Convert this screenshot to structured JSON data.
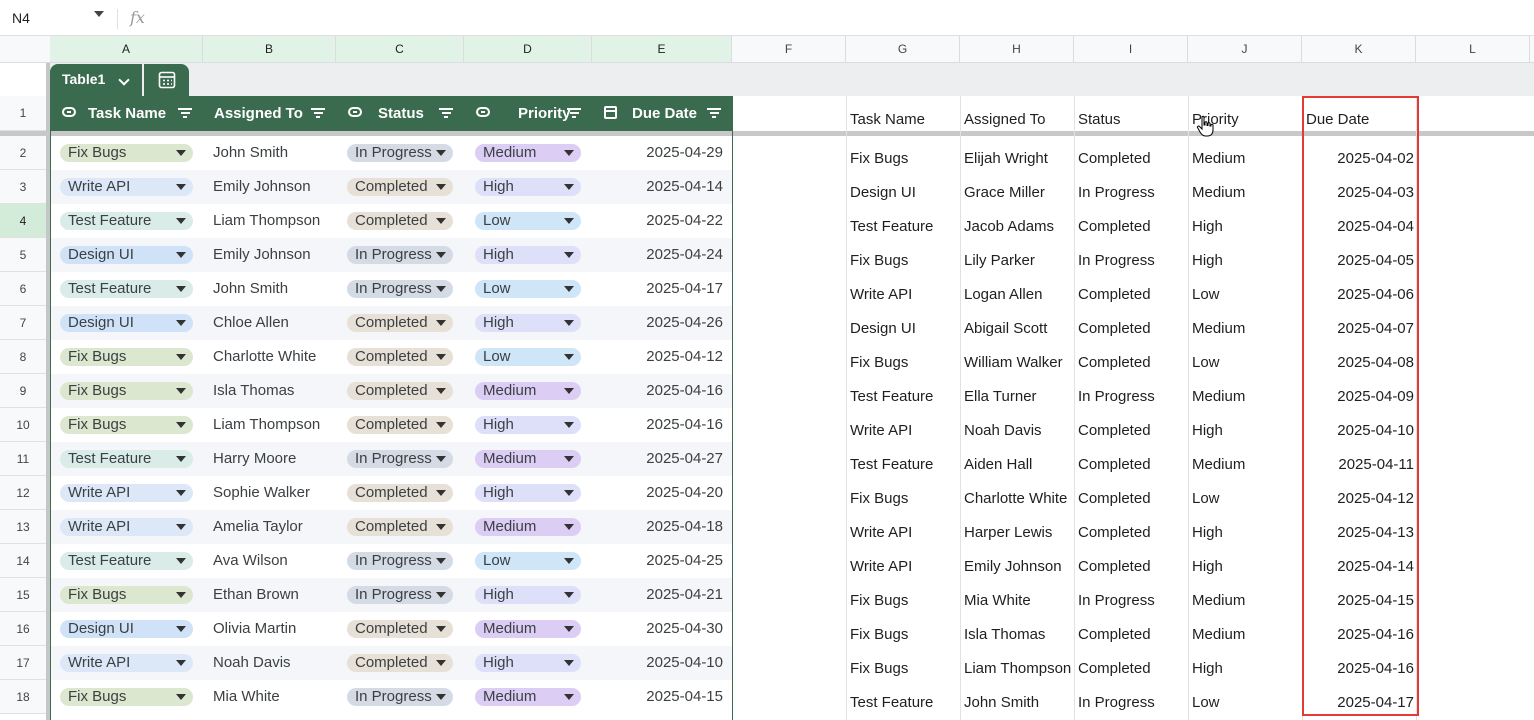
{
  "formula_bar": {
    "name_box": "N4",
    "fx": "fx",
    "formula": ""
  },
  "columns": [
    "A",
    "B",
    "C",
    "D",
    "E",
    "F",
    "G",
    "H",
    "I",
    "J",
    "K",
    "L"
  ],
  "row_numbers": [
    "1",
    "2",
    "3",
    "4",
    "5",
    "6",
    "7",
    "8",
    "9",
    "10",
    "11",
    "12",
    "13",
    "14",
    "15",
    "16",
    "17",
    "18"
  ],
  "selected_row": "4",
  "table": {
    "name": "Table1",
    "headers": [
      "Task Name",
      "Assigned To",
      "Status",
      "Priority",
      "Due Date"
    ],
    "header_color": "#3a6b4e",
    "rows": [
      [
        "Fix Bugs",
        "John Smith",
        "In Progress",
        "Medium",
        "2025-04-29"
      ],
      [
        "Write API",
        "Emily Johnson",
        "Completed",
        "High",
        "2025-04-14"
      ],
      [
        "Test Feature",
        "Liam Thompson",
        "Completed",
        "Low",
        "2025-04-22"
      ],
      [
        "Design UI",
        "Emily Johnson",
        "In Progress",
        "High",
        "2025-04-24"
      ],
      [
        "Test Feature",
        "John Smith",
        "In Progress",
        "Low",
        "2025-04-17"
      ],
      [
        "Design UI",
        "Chloe Allen",
        "Completed",
        "High",
        "2025-04-26"
      ],
      [
        "Fix Bugs",
        "Charlotte White",
        "Completed",
        "Low",
        "2025-04-12"
      ],
      [
        "Fix Bugs",
        "Isla Thomas",
        "Completed",
        "Medium",
        "2025-04-16"
      ],
      [
        "Fix Bugs",
        "Liam Thompson",
        "Completed",
        "High",
        "2025-04-16"
      ],
      [
        "Test Feature",
        "Harry Moore",
        "In Progress",
        "Medium",
        "2025-04-27"
      ],
      [
        "Write API",
        "Sophie Walker",
        "Completed",
        "High",
        "2025-04-20"
      ],
      [
        "Write API",
        "Amelia Taylor",
        "Completed",
        "Medium",
        "2025-04-18"
      ],
      [
        "Test Feature",
        "Ava Wilson",
        "In Progress",
        "Low",
        "2025-04-25"
      ],
      [
        "Fix Bugs",
        "Ethan Brown",
        "In Progress",
        "High",
        "2025-04-21"
      ],
      [
        "Design UI",
        "Olivia Martin",
        "Completed",
        "Medium",
        "2025-04-30"
      ],
      [
        "Write API",
        "Noah Davis",
        "Completed",
        "High",
        "2025-04-10"
      ],
      [
        "Fix Bugs",
        "Mia White",
        "In Progress",
        "Medium",
        "2025-04-15"
      ]
    ],
    "chip_colors": {
      "Fix Bugs": "#dbe7cf",
      "Write API": "#dce8f8",
      "Test Feature": "#d9ece8",
      "Design UI": "#cfe2f8",
      "In Progress": "#d5dbe5",
      "Completed": "#e6e0d6",
      "Medium": "#dccdf5",
      "High": "#dde0f8",
      "Low": "#cfe5f8"
    }
  },
  "right_table": {
    "headers": [
      "Task Name",
      "Assigned To",
      "Status",
      "Priority",
      "Due Date"
    ],
    "rows": [
      [
        "Fix Bugs",
        "Elijah Wright",
        "Completed",
        "Medium",
        "2025-04-02"
      ],
      [
        "Design UI",
        "Grace Miller",
        "In Progress",
        "Medium",
        "2025-04-03"
      ],
      [
        "Test Feature",
        "Jacob Adams",
        "Completed",
        "High",
        "2025-04-04"
      ],
      [
        "Fix Bugs",
        "Lily Parker",
        "In Progress",
        "High",
        "2025-04-05"
      ],
      [
        "Write API",
        "Logan Allen",
        "Completed",
        "Low",
        "2025-04-06"
      ],
      [
        "Design UI",
        "Abigail Scott",
        "Completed",
        "Medium",
        "2025-04-07"
      ],
      [
        "Fix Bugs",
        "William Walker",
        "Completed",
        "Low",
        "2025-04-08"
      ],
      [
        "Test Feature",
        "Ella Turner",
        "In Progress",
        "Medium",
        "2025-04-09"
      ],
      [
        "Write API",
        "Noah Davis",
        "Completed",
        "High",
        "2025-04-10"
      ],
      [
        "Test Feature",
        "Aiden Hall",
        "Completed",
        "Medium",
        "2025-04-11"
      ],
      [
        "Fix Bugs",
        "Charlotte White",
        "Completed",
        "Low",
        "2025-04-12"
      ],
      [
        "Write API",
        "Harper Lewis",
        "Completed",
        "High",
        "2025-04-13"
      ],
      [
        "Write API",
        "Emily Johnson",
        "Completed",
        "High",
        "2025-04-14"
      ],
      [
        "Fix Bugs",
        "Mia White",
        "In Progress",
        "Medium",
        "2025-04-15"
      ],
      [
        "Fix Bugs",
        "Isla Thomas",
        "Completed",
        "Medium",
        "2025-04-16"
      ],
      [
        "Fix Bugs",
        "Liam Thompson",
        "Completed",
        "High",
        "2025-04-16"
      ],
      [
        "Test Feature",
        "John Smith",
        "In Progress",
        "Low",
        "2025-04-17"
      ]
    ],
    "highlight_color": "#e53935"
  }
}
